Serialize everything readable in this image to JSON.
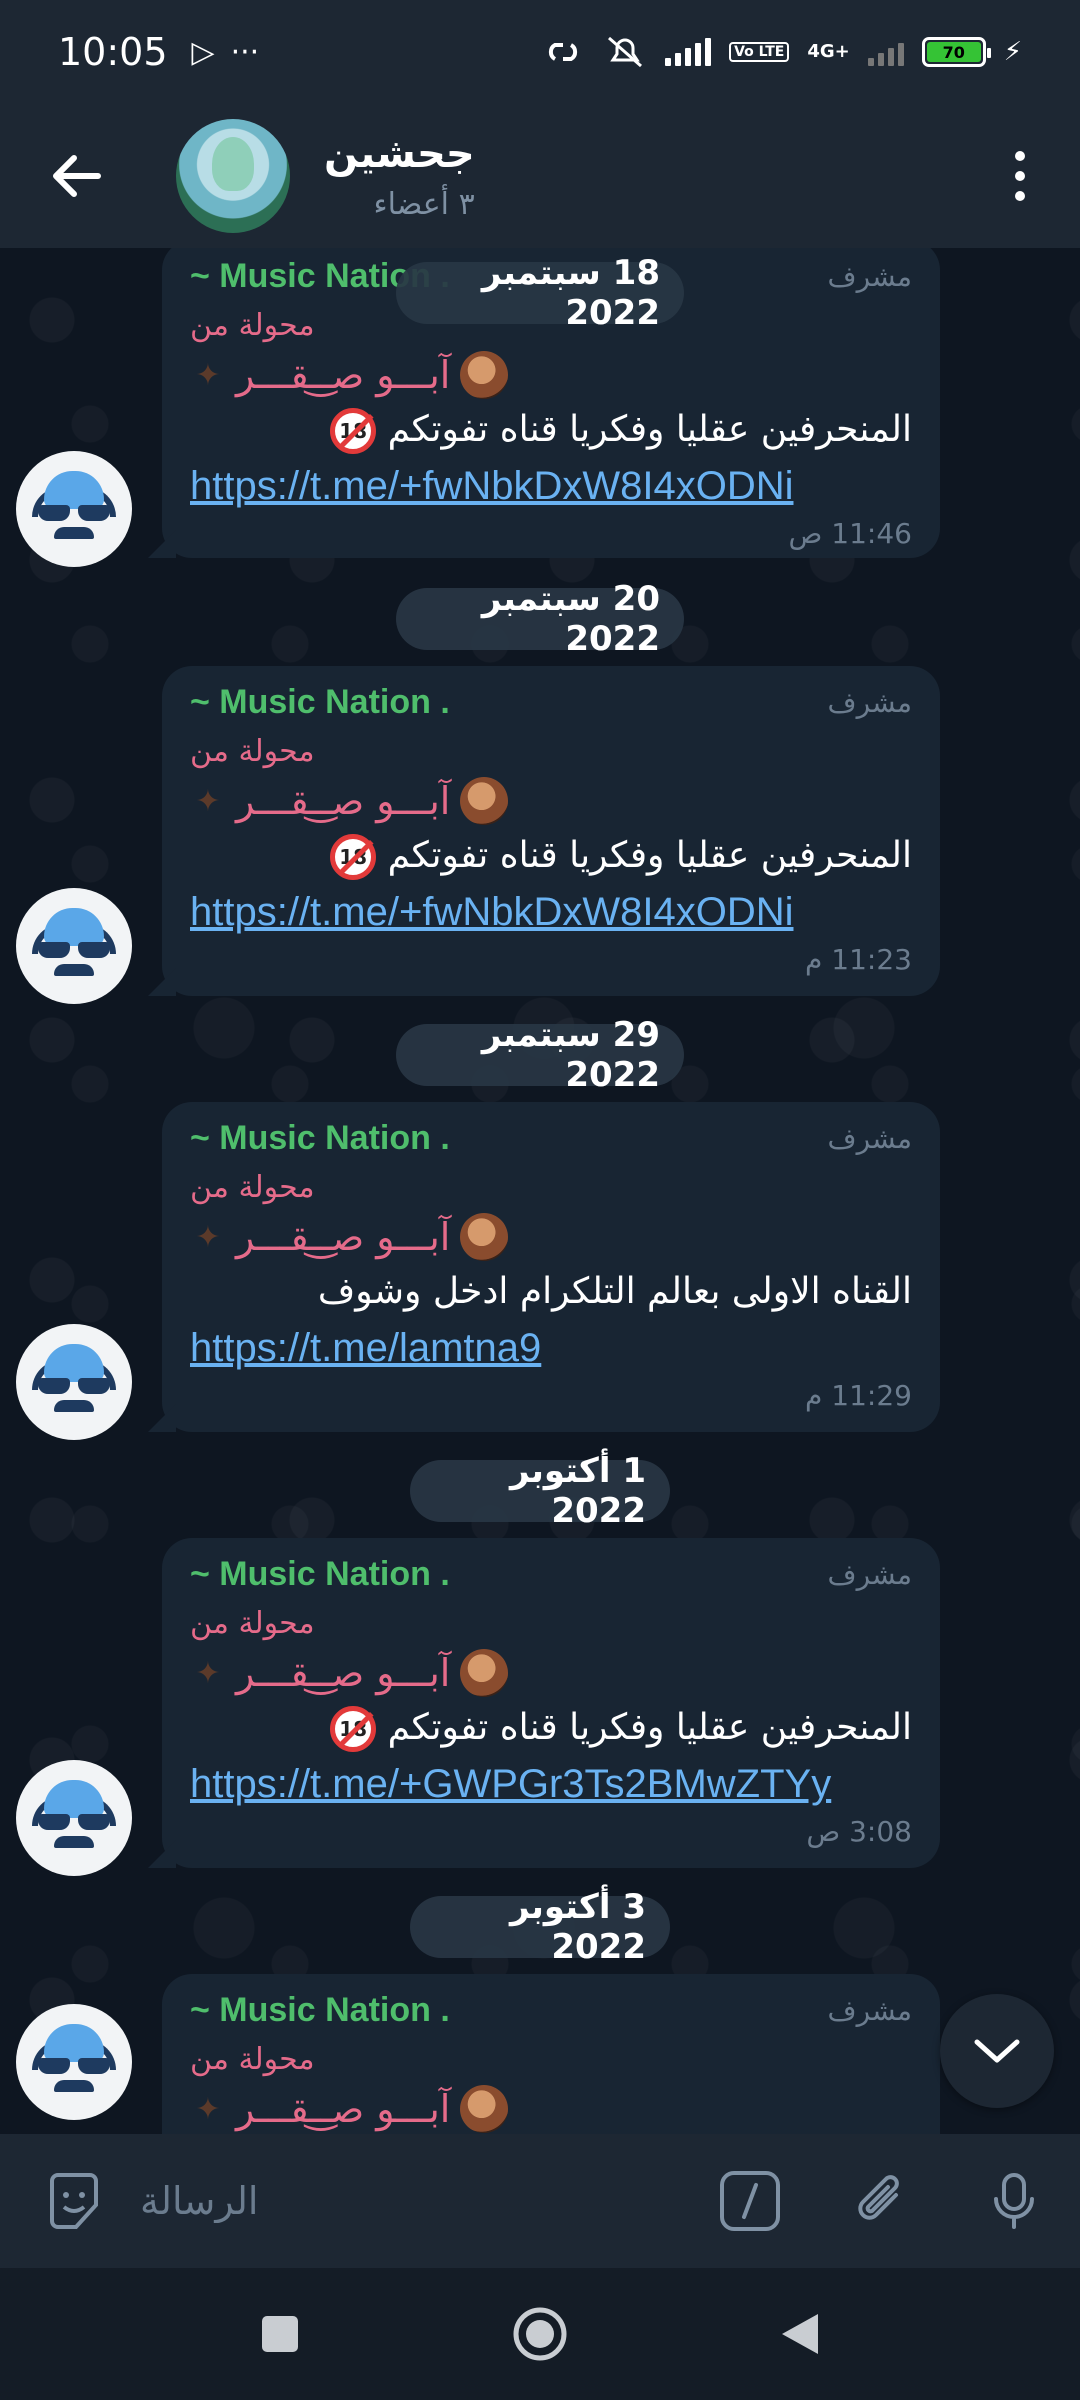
{
  "status_bar": {
    "time": "10:05",
    "battery": "70",
    "network": "4G+",
    "volte": "Vo LTE"
  },
  "header": {
    "title": "جحشين",
    "subtitle": "٣ أعضاء"
  },
  "messages": [
    {
      "date": "18 سبتمبر 2022",
      "sender": "~ Music Nation .",
      "role": "مشرف",
      "forwarded_label": "محولة من",
      "forwarded_from": "آبـــو صـ͜ـقـــر",
      "text": "المنحرفين عقليا وفكريا قناه تفوتكم",
      "link": "https://t.me/+fwNbkDxW8I4xODNi",
      "time": "11:46 ص"
    },
    {
      "date": "20 سبتمبر 2022",
      "sender": "~ Music Nation .",
      "role": "مشرف",
      "forwarded_label": "محولة من",
      "forwarded_from": "آبـــو صـ͜ـقـــر",
      "text": "المنحرفين عقليا وفكريا قناه تفوتكم",
      "link": "https://t.me/+fwNbkDxW8I4xODNi",
      "time": "11:23 م"
    },
    {
      "date": "29 سبتمبر 2022",
      "sender": "~ Music Nation .",
      "role": "مشرف",
      "forwarded_label": "محولة من",
      "forwarded_from": "آبـــو صـ͜ـقـــر",
      "text": "القناه الاولى بعالم التلكرام ادخل وشوف",
      "link": "https://t.me/lamtna9",
      "time": "11:29 م"
    },
    {
      "date": "1 أكتوبر 2022",
      "sender": "~ Music Nation .",
      "role": "مشرف",
      "forwarded_label": "محولة من",
      "forwarded_from": "آبـــو صـ͜ـقـــر",
      "text": "المنحرفين عقليا وفكريا قناه تفوتكم",
      "link": "https://t.me/+GWPGr3Ts2BMwZTYy",
      "time": "3:08 ص"
    },
    {
      "date": "3 أكتوبر 2022",
      "sender": "~ Music Nation .",
      "role": "مشرف",
      "forwarded_label": "محولة من",
      "forwarded_from": "آبـــو صـ͜ـقـــر"
    }
  ],
  "input": {
    "placeholder": "الرسالة"
  },
  "colors": {
    "background": "#0e1621",
    "bar": "#1d2733",
    "bubble": "#182533",
    "sender": "#4fbe6c",
    "forward": "#e56b8a",
    "link": "#6ab2f2",
    "muted": "#6b7c8e"
  }
}
